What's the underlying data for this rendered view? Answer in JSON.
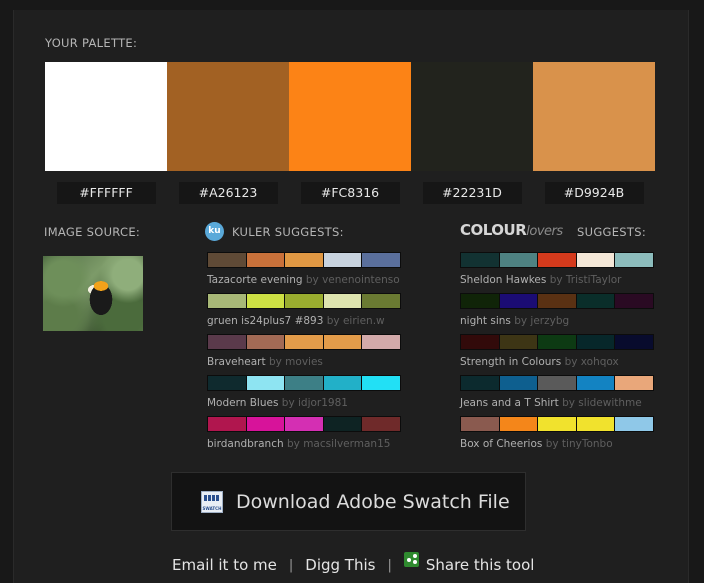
{
  "palette": {
    "label": "YOUR PALETTE:",
    "swatches": [
      {
        "hex": "#FFFFFF",
        "label": "#FFFFFF"
      },
      {
        "hex": "#A26123",
        "label": "#A26123"
      },
      {
        "hex": "#FC8316",
        "label": "#FC8316"
      },
      {
        "hex": "#22231D",
        "label": "#22231D"
      },
      {
        "hex": "#D9924B",
        "label": "#D9924B"
      }
    ]
  },
  "image_source": {
    "label": "IMAGE SOURCE:",
    "icon": "toucan-photo-thumbnail"
  },
  "kuler": {
    "badge_text": "ku",
    "label": "KULER SUGGESTS:",
    "items": [
      {
        "name": "Tazacorte evening",
        "by": "by venenointenso",
        "colors": [
          "#5f4a36",
          "#c9713a",
          "#e09843",
          "#c8d3de",
          "#5a6f9c"
        ]
      },
      {
        "name": "gruen is24plus7 #893",
        "by": "by eirien.w",
        "colors": [
          "#a8b877",
          "#cde044",
          "#9aad2f",
          "#dde3ae",
          "#6a7a32"
        ]
      },
      {
        "name": "Braveheart",
        "by": "by movies",
        "colors": [
          "#5a3a4b",
          "#a26a55",
          "#e39c4a",
          "#e39c4a",
          "#d3aaaa"
        ]
      },
      {
        "name": "Modern Blues",
        "by": "by idjor1981",
        "colors": [
          "#0f2a2e",
          "#8ee4f2",
          "#3d7f86",
          "#22b0c8",
          "#22e0f5"
        ]
      },
      {
        "name": "birdandbranch",
        "by": "by macsilverman15",
        "colors": [
          "#b0164e",
          "#d7139a",
          "#d42fb3",
          "#0e2323",
          "#6f2a2a"
        ]
      }
    ]
  },
  "colourlovers": {
    "logo_colour": "COLOUR",
    "logo_lovers": "lovers",
    "label": "SUGGESTS:",
    "items": [
      {
        "name": "Sheldon Hawkes",
        "by": "by TristiTaylor",
        "colors": [
          "#123232",
          "#4e8282",
          "#d43a1c",
          "#f3e6d6",
          "#8cbcbc"
        ]
      },
      {
        "name": "night sins",
        "by": "by jerzybg",
        "colors": [
          "#102408",
          "#1b0c74",
          "#5a3113",
          "#0a2e2a",
          "#2a0a23"
        ]
      },
      {
        "name": "Strength in Colours",
        "by": "by xohqox",
        "colors": [
          "#320a0a",
          "#3d3515",
          "#0d3a13",
          "#07272a",
          "#080b2d"
        ]
      },
      {
        "name": "Jeans and a T Shirt",
        "by": "by slidewithme",
        "colors": [
          "#0c2a2e",
          "#0e5f8f",
          "#5a5a5a",
          "#1383c2",
          "#e9a77a"
        ]
      },
      {
        "name": "Box of Cheerios",
        "by": "by tinyTonbo",
        "colors": [
          "#8a5a4f",
          "#f4861a",
          "#f1e22d",
          "#f1e22d",
          "#8fc8e8"
        ]
      }
    ]
  },
  "download": {
    "label": "Download Adobe Swatch File",
    "icon_text": "SWATCH"
  },
  "footer": {
    "email": "Email it to me",
    "digg": "Digg This",
    "share": "Share this tool",
    "separator": "|"
  }
}
